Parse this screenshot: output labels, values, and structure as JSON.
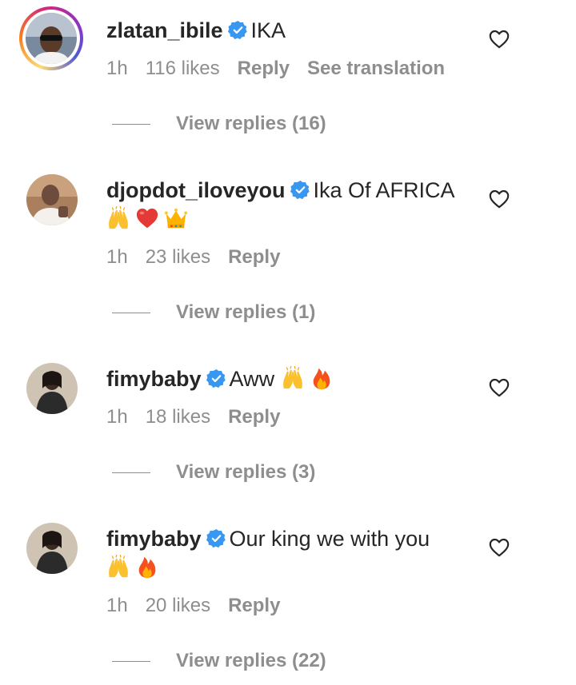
{
  "comments": [
    {
      "username": "zlatan_ibile",
      "text": "IKA",
      "emojis": [],
      "time": "1h",
      "likes": "116 likes",
      "reply_label": "Reply",
      "translation_label": "See translation",
      "view_replies": "View replies (16)"
    },
    {
      "username": "djopdot_iloveyou",
      "text": "Ika Of AFRICA",
      "emojis": [
        "raising-hands",
        "red-heart",
        "crown"
      ],
      "time": "1h",
      "likes": "23 likes",
      "reply_label": "Reply",
      "view_replies": "View replies (1)"
    },
    {
      "username": "fimybaby",
      "text": "Aww",
      "emojis": [
        "raising-hands",
        "fire"
      ],
      "time": "1h",
      "likes": "18 likes",
      "reply_label": "Reply",
      "view_replies": "View replies (3)"
    },
    {
      "username": "fimybaby",
      "text": "Our king we with you",
      "emojis": [
        "raising-hands",
        "fire"
      ],
      "time": "1h",
      "likes": "20 likes",
      "reply_label": "Reply",
      "view_replies": "View replies (22)"
    }
  ],
  "colors": {
    "verified_badge": "#3897f0",
    "secondary_text": "#8e8e8e",
    "primary_text": "#262626"
  }
}
